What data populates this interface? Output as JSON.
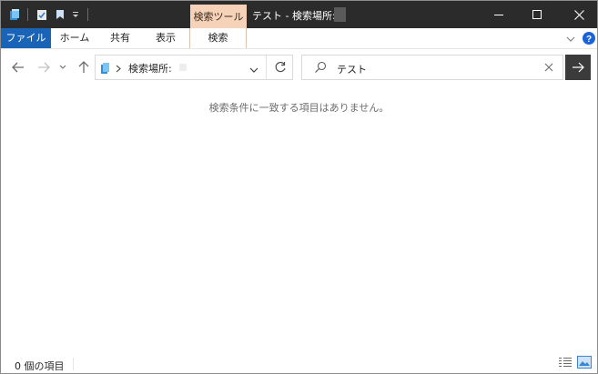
{
  "titlebar": {
    "title": "テスト - 検索場所:",
    "context_tab": "検索ツール",
    "qa_icons": [
      "explorer-icon",
      "properties-icon",
      "new-folder-icon",
      "customize-chevron-icon"
    ]
  },
  "ribbon": {
    "tabs": [
      "ファイル",
      "ホーム",
      "共有",
      "表示",
      "検索"
    ]
  },
  "address": {
    "path": "検索場所:"
  },
  "search": {
    "value": "テスト"
  },
  "content": {
    "empty_message": "検索条件に一致する項目はありません。"
  },
  "status": {
    "item_count": "0 個の項目"
  },
  "colors": {
    "titlebar": "#2b2b2b",
    "file_tab": "#1a64b8",
    "context_tab": "#f6d3b8",
    "go_button": "#3b3b3b",
    "help": "#1a64d8"
  }
}
